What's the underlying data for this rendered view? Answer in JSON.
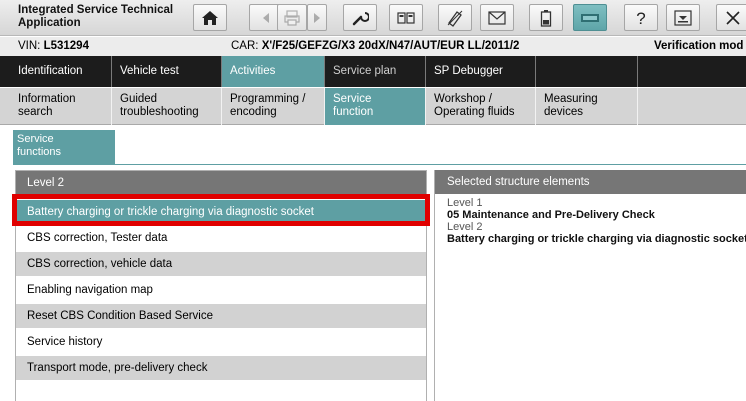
{
  "app": {
    "title": "Integrated Service Technical Application"
  },
  "toolbar": {
    "buttons": [
      {
        "icon": "home-icon"
      },
      {
        "icon": "back-arrow-icon"
      },
      {
        "icon": "print-icon"
      },
      {
        "icon": "forward-arrow-icon"
      },
      {
        "icon": "wrench-icon"
      },
      {
        "icon": "two-panels-icon"
      },
      {
        "icon": "eraser-icon"
      },
      {
        "icon": "envelope-icon"
      },
      {
        "icon": "battery-icon"
      },
      {
        "icon": "vci-connection-icon"
      },
      {
        "icon": "help-icon"
      },
      {
        "icon": "dropdown-menu-icon"
      },
      {
        "icon": "close-icon"
      }
    ]
  },
  "vehicle": {
    "vin_label": "VIN:",
    "vin": "L531294",
    "car_label": "CAR:",
    "car": "X'/F25/GEFZG/X3 20dX/N47/AUT/EUR LL/2011/2",
    "mode": "Verification mod"
  },
  "main_tabs": [
    {
      "label": "Identification"
    },
    {
      "label": "Vehicle test"
    },
    {
      "label": "Activities"
    },
    {
      "label": "Service plan"
    },
    {
      "label": "SP Debugger"
    }
  ],
  "sub_tabs": [
    {
      "line1": "Information",
      "line2": "search"
    },
    {
      "line1": "Guided",
      "line2": "troubleshooting"
    },
    {
      "line1": "Programming /",
      "line2": "encoding"
    },
    {
      "line1": "Service",
      "line2": "function"
    },
    {
      "line1": "Workshop /",
      "line2": "Operating fluids"
    },
    {
      "line1": "Measuring",
      "line2": "devices"
    }
  ],
  "section_tab": {
    "line1": "Service",
    "line2": "functions"
  },
  "left_panel": {
    "header": "Level 2",
    "items": [
      {
        "label": "Battery charging or trickle charging via diagnostic socket"
      },
      {
        "label": "CBS correction, Tester data"
      },
      {
        "label": "CBS correction, vehicle data"
      },
      {
        "label": "Enabling navigation map"
      },
      {
        "label": "Reset CBS Condition Based Service"
      },
      {
        "label": "Service history"
      },
      {
        "label": "Transport mode, pre-delivery check"
      }
    ]
  },
  "right_panel": {
    "header": "Selected structure elements",
    "level1_label": "Level 1",
    "level1_value": "05 Maintenance and Pre-Delivery Check",
    "level2_label": "Level 2",
    "level2_value": "Battery charging or trickle charging via diagnostic socket"
  },
  "colors": {
    "accent_teal": "#5e9fa3",
    "nav_dark": "#1c1c1c",
    "header_gray": "#767676",
    "highlight_red": "#e00000"
  }
}
